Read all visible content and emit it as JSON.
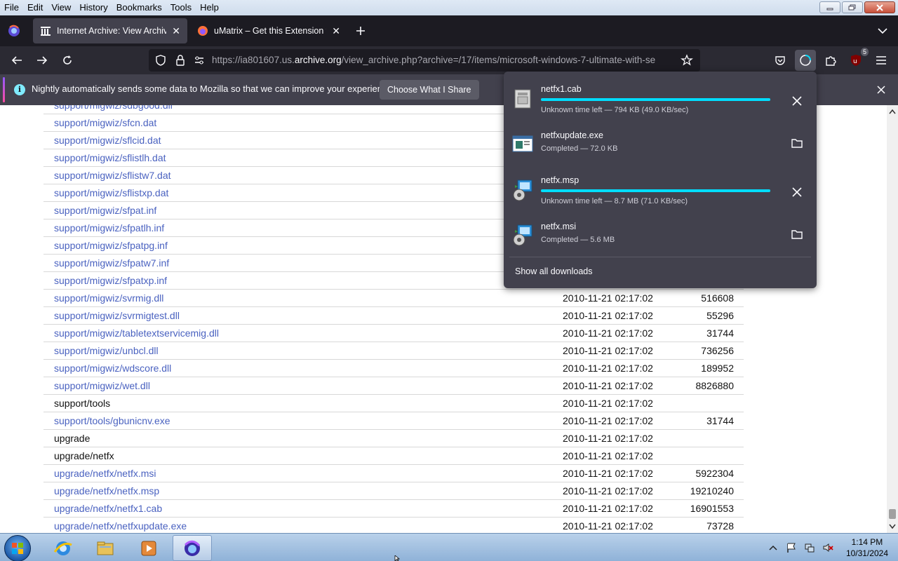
{
  "menubar": {
    "items": [
      {
        "label": "File"
      },
      {
        "label": "Edit"
      },
      {
        "label": "View"
      },
      {
        "label": "History"
      },
      {
        "label": "Bookmarks"
      },
      {
        "label": "Tools"
      },
      {
        "label": "Help"
      }
    ]
  },
  "tabs": [
    {
      "title": "Internet Archive: View Archive",
      "icon": "archive-icon",
      "active": true
    },
    {
      "title": "uMatrix – Get this Extension for",
      "icon": "firefox-icon",
      "active": false
    }
  ],
  "navbar": {
    "url_prefix": "https://ia801607.us.",
    "url_host": "archive.org",
    "url_suffix": "/view_archive.php?archive=/17/items/microsoft-windows-7-ultimate-with-se",
    "extension_badge": "5"
  },
  "notification": {
    "text": "Nightly automatically sends some data to Mozilla so that we can improve your experience.",
    "button": "Choose What I Share",
    "info_glyph": "i"
  },
  "files": [
    {
      "name": "support/migwiz/sdbgood.dll",
      "date": "",
      "size": "",
      "link": true
    },
    {
      "name": "support/migwiz/sfcn.dat",
      "date": "",
      "size": "",
      "link": true
    },
    {
      "name": "support/migwiz/sflcid.dat",
      "date": "",
      "size": "",
      "link": true
    },
    {
      "name": "support/migwiz/sflistlh.dat",
      "date": "",
      "size": "",
      "link": true
    },
    {
      "name": "support/migwiz/sflistw7.dat",
      "date": "",
      "size": "",
      "link": true
    },
    {
      "name": "support/migwiz/sflistxp.dat",
      "date": "",
      "size": "",
      "link": true
    },
    {
      "name": "support/migwiz/sfpat.inf",
      "date": "",
      "size": "",
      "link": true
    },
    {
      "name": "support/migwiz/sfpatlh.inf",
      "date": "",
      "size": "",
      "link": true
    },
    {
      "name": "support/migwiz/sfpatpg.inf",
      "date": "",
      "size": "",
      "link": true
    },
    {
      "name": "support/migwiz/sfpatw7.inf",
      "date": "",
      "size": "",
      "link": true
    },
    {
      "name": "support/migwiz/sfpatxp.inf",
      "date": "",
      "size": "",
      "link": true
    },
    {
      "name": "support/migwiz/svrmig.dll",
      "date": "2010-11-21 02:17:02",
      "size": "516608",
      "link": true
    },
    {
      "name": "support/migwiz/svrmigtest.dll",
      "date": "2010-11-21 02:17:02",
      "size": "55296",
      "link": true
    },
    {
      "name": "support/migwiz/tabletextservicemig.dll",
      "date": "2010-11-21 02:17:02",
      "size": "31744",
      "link": true
    },
    {
      "name": "support/migwiz/unbcl.dll",
      "date": "2010-11-21 02:17:02",
      "size": "736256",
      "link": true
    },
    {
      "name": "support/migwiz/wdscore.dll",
      "date": "2010-11-21 02:17:02",
      "size": "189952",
      "link": true
    },
    {
      "name": "support/migwiz/wet.dll",
      "date": "2010-11-21 02:17:02",
      "size": "8826880",
      "link": true
    },
    {
      "name": "support/tools",
      "date": "2010-11-21 02:17:02",
      "size": "",
      "link": false
    },
    {
      "name": "support/tools/gbunicnv.exe",
      "date": "2010-11-21 02:17:02",
      "size": "31744",
      "link": true
    },
    {
      "name": "upgrade",
      "date": "2010-11-21 02:17:02",
      "size": "",
      "link": false
    },
    {
      "name": "upgrade/netfx",
      "date": "2010-11-21 02:17:02",
      "size": "",
      "link": false
    },
    {
      "name": "upgrade/netfx/netfx.msi",
      "date": "2010-11-21 02:17:02",
      "size": "5922304",
      "link": true
    },
    {
      "name": "upgrade/netfx/netfx.msp",
      "date": "2010-11-21 02:17:02",
      "size": "19210240",
      "link": true
    },
    {
      "name": "upgrade/netfx/netfx1.cab",
      "date": "2010-11-21 02:17:02",
      "size": "16901553",
      "link": true
    },
    {
      "name": "upgrade/netfx/netfxupdate.exe",
      "date": "2010-11-21 02:17:02",
      "size": "73728",
      "link": true
    }
  ],
  "downloads": {
    "items": [
      {
        "name": "netfx1.cab",
        "status": "Unknown time left — 794 KB (49.0 KB/sec)",
        "in_progress": true,
        "progress": 1.0,
        "icon": "cab-file-icon",
        "action": "cancel"
      },
      {
        "name": "netfxupdate.exe",
        "status": "Completed — 72.0 KB",
        "in_progress": false,
        "icon": "exe-file-icon",
        "action": "open-folder"
      },
      {
        "name": "netfx.msp",
        "status": "Unknown time left — 8.7 MB (71.0 KB/sec)",
        "in_progress": true,
        "progress": 1.0,
        "icon": "installer-file-icon",
        "action": "cancel"
      },
      {
        "name": "netfx.msi",
        "status": "Completed — 5.6 MB",
        "in_progress": false,
        "icon": "installer-file-icon",
        "action": "open-folder"
      }
    ],
    "show_all": "Show all downloads"
  },
  "taskbar": {
    "apps": [
      {
        "name": "internet-explorer"
      },
      {
        "name": "file-explorer"
      },
      {
        "name": "media-player"
      },
      {
        "name": "firefox-nightly",
        "active": true
      }
    ],
    "time": "1:14 PM",
    "date": "10/31/2024"
  },
  "colors": {
    "accent": "#00ddff",
    "link": "#4a62c0",
    "panel": "#42414d",
    "toolbar": "#2b2a33"
  }
}
